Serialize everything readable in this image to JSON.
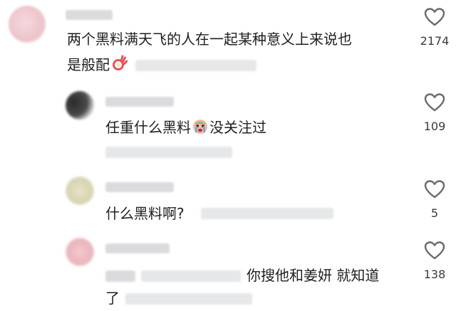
{
  "comments": [
    {
      "text_line1": "两个黑料满天飞的人在一起某种意义上来说也",
      "text_line2": "是般配",
      "emoji": "ok-hand-emoji",
      "likes": "2174"
    },
    {
      "text_before": "任重什么黑料",
      "emoji": "crying-face-emoji",
      "text_after": "没关注过",
      "likes": "109"
    },
    {
      "text": "什么黑料啊?",
      "likes": "5"
    },
    {
      "text_line1": "你搜他和姜妍 就知道",
      "text_line2": "了",
      "likes": "138"
    }
  ],
  "colors": {
    "text": "#1f1f1f",
    "count": "#3a3a3a",
    "icon": "#6b6b6b",
    "redacted": "#cfd0d3"
  }
}
